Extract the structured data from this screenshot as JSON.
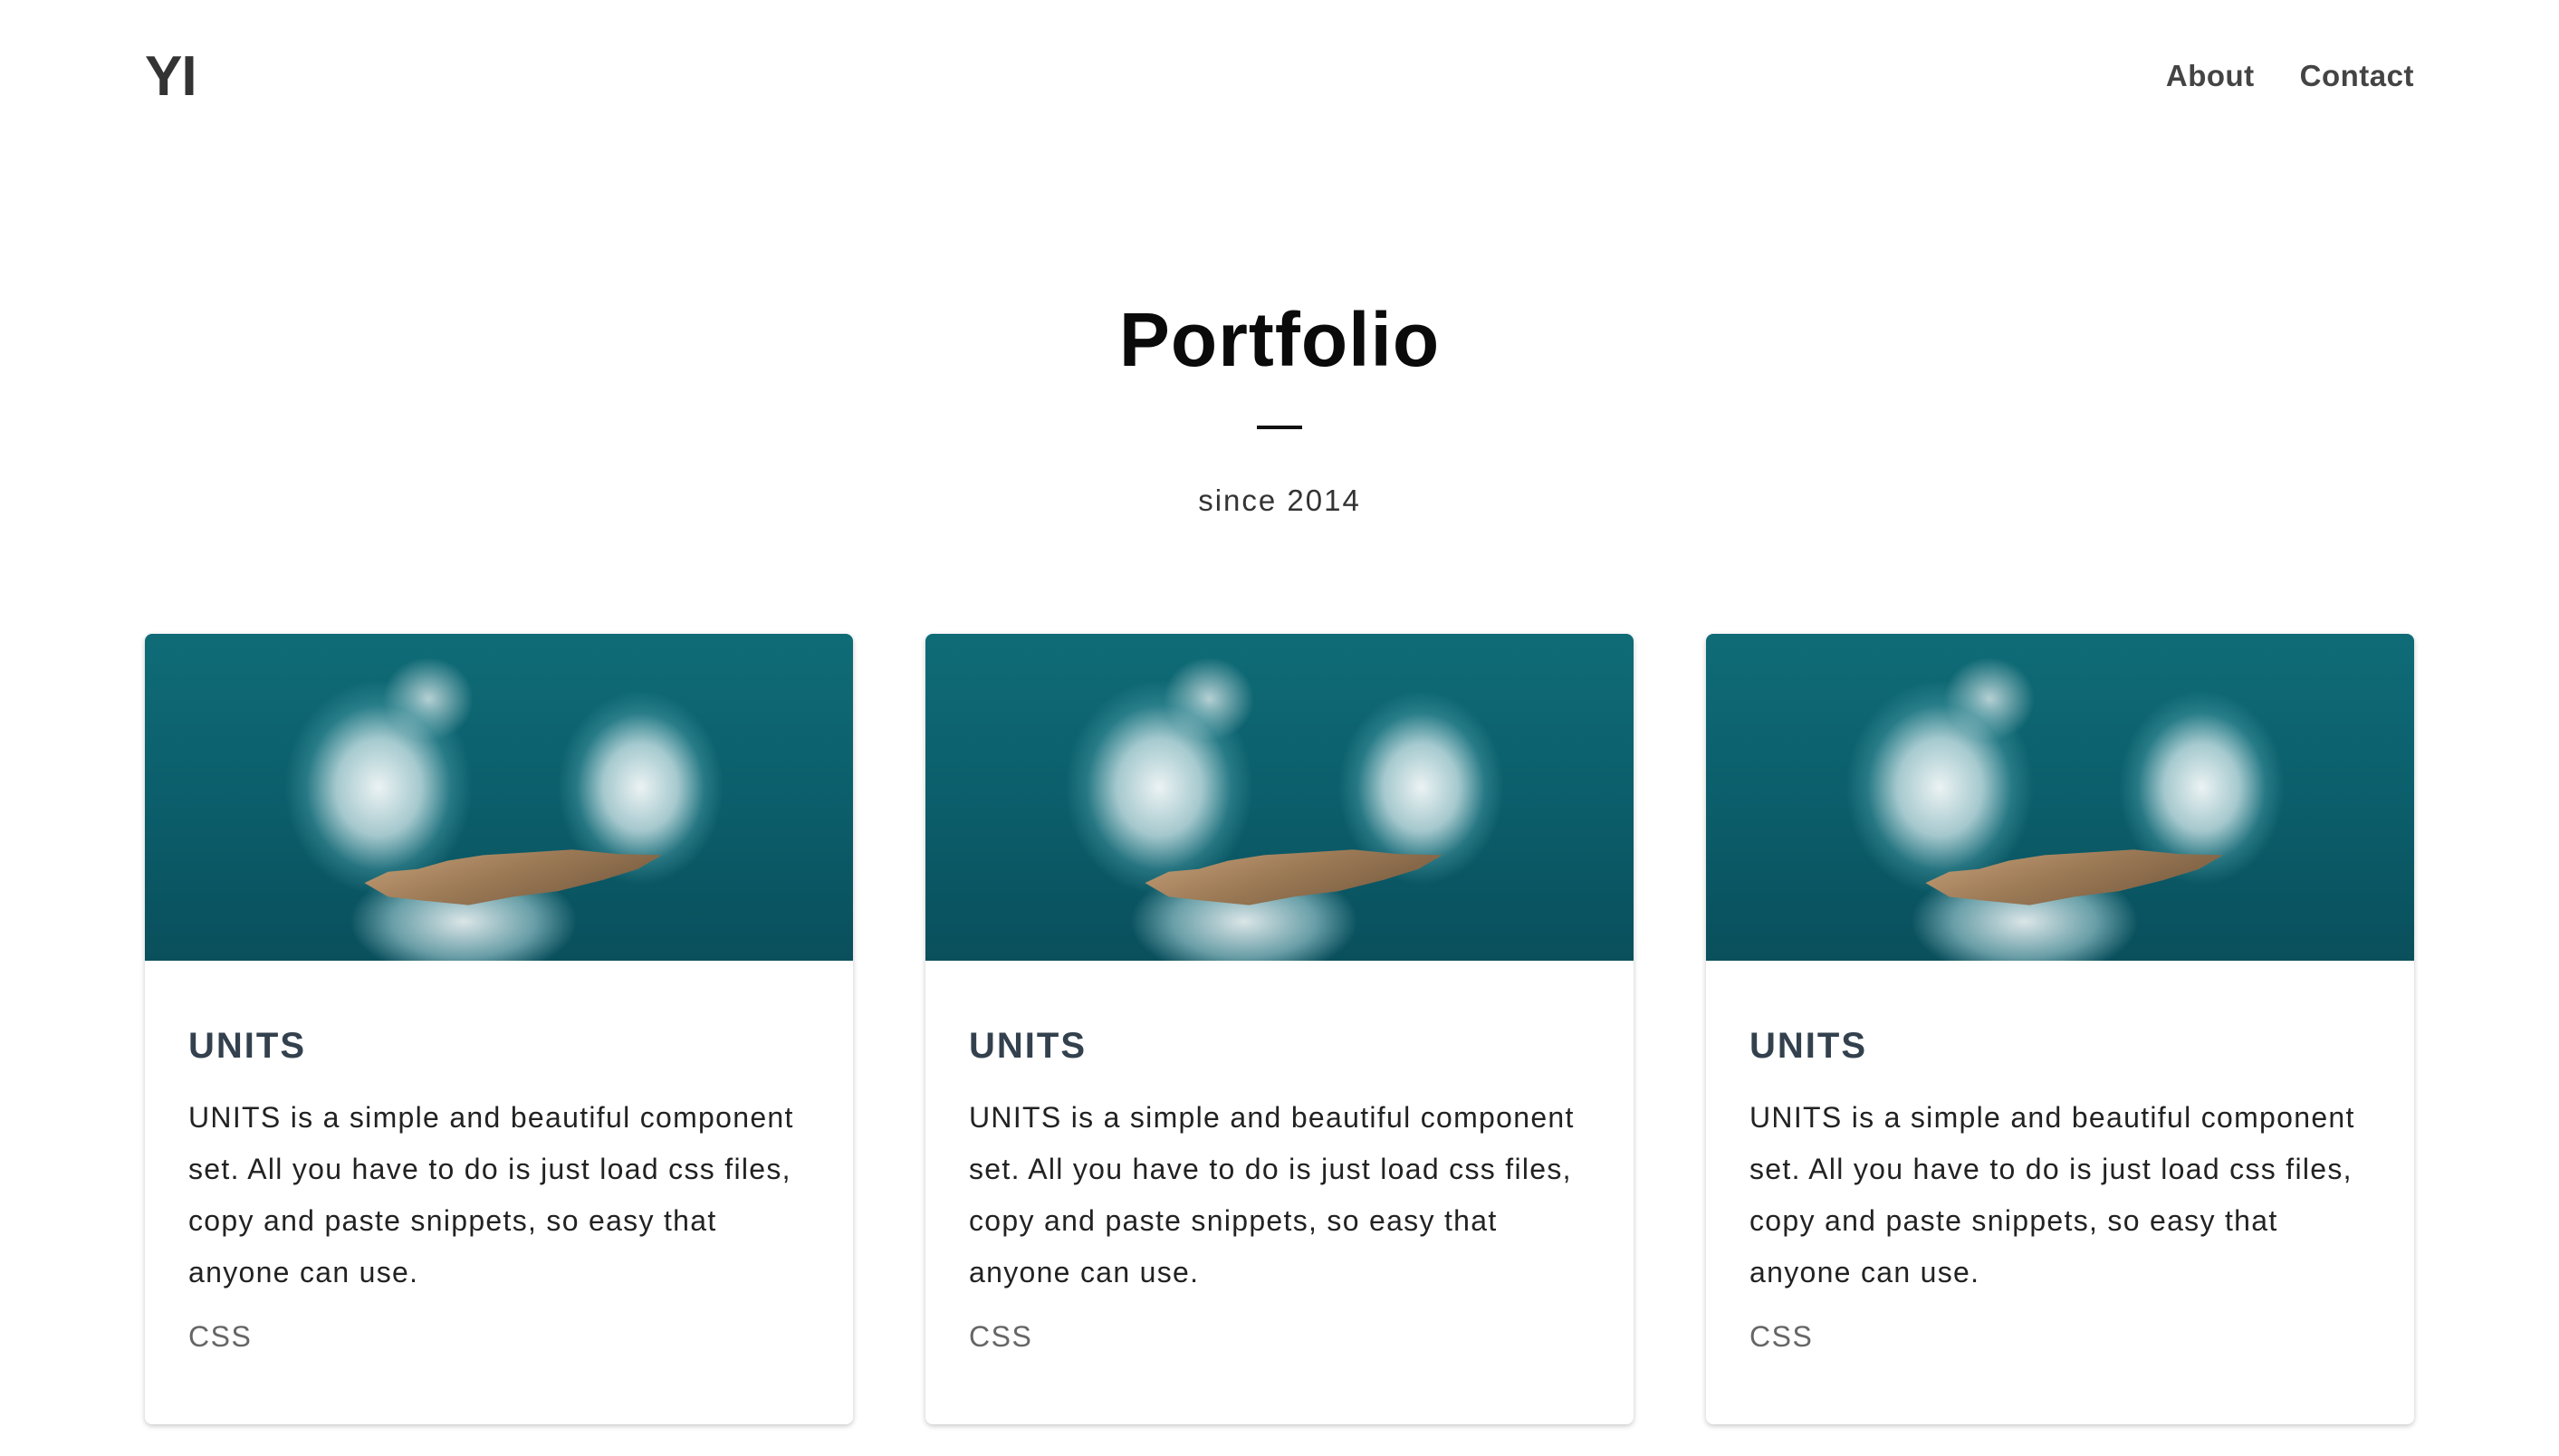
{
  "header": {
    "logo": "YI",
    "nav": [
      {
        "label": "About"
      },
      {
        "label": "Contact"
      }
    ]
  },
  "hero": {
    "title": "Portfolio",
    "subtitle": "since 2014"
  },
  "cards": [
    {
      "title": "UNITS",
      "text": "UNITS is a simple and beautiful component set. All you have to do is just load css files, copy and paste snippets, so easy that anyone can use.",
      "tag": "CSS"
    },
    {
      "title": "UNITS",
      "text": "UNITS is a simple and beautiful component set. All you have to do is just load css files, copy and paste snippets, so easy that anyone can use.",
      "tag": "CSS"
    },
    {
      "title": "UNITS",
      "text": "UNITS is a simple and beautiful component set. All you have to do is just load css files, copy and paste snippets, so easy that anyone can use.",
      "tag": "CSS"
    }
  ]
}
